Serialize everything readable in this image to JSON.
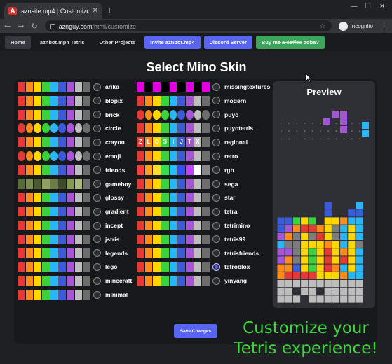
{
  "browser": {
    "tab_title": "aznsite.mp4 | Customize",
    "url_host": "aznguy.com",
    "url_path": "/html/customize",
    "profile_label": "Incognito"
  },
  "nav": {
    "items": [
      {
        "label": "Home",
        "style": "active"
      },
      {
        "label": "aznbot.mp4 Tetris",
        "style": "plain"
      },
      {
        "label": "Other Projects",
        "style": "plain"
      },
      {
        "label": "Invite aznbot.mp4",
        "style": "blue"
      },
      {
        "label": "Discord Server",
        "style": "blue"
      }
    ],
    "boba": {
      "prefix": "Buy me ",
      "struck": "a coffee",
      "suffix": " boba?"
    }
  },
  "page": {
    "title": "Select Mino Skin",
    "preview_title": "Preview",
    "save_label": "Save Changes",
    "promo_line1": "Customize your",
    "promo_line2": "Tetris experience!"
  },
  "skins": {
    "left": [
      "arika",
      "blopix",
      "brick",
      "circle",
      "crayon",
      "emoji",
      "friends",
      "gameboy",
      "glossy",
      "gradient",
      "incept",
      "jstris",
      "legends",
      "lego",
      "minecraft",
      "minimal"
    ],
    "right": [
      "missingtextures",
      "modern",
      "puyo",
      "puyotetris",
      "regional",
      "retro",
      "rgb",
      "sega",
      "star",
      "tetra",
      "tetrimino",
      "tetris99",
      "tetrisfriends",
      "tetroblox",
      "yinyang"
    ],
    "selected": "tetroblox",
    "regional_letters": [
      "Z",
      "L",
      "O",
      "S",
      "I",
      "J",
      "T",
      "X"
    ]
  },
  "colors": {
    "accent": "#5865f2",
    "green": "#3ba55c",
    "promo": "#3bd83b",
    "mino": [
      "#e53935",
      "#ff8c1a",
      "#ffd600",
      "#3bd33b",
      "#29b6f6",
      "#3a5cd8",
      "#a456d6",
      "#9e9e9e"
    ]
  }
}
